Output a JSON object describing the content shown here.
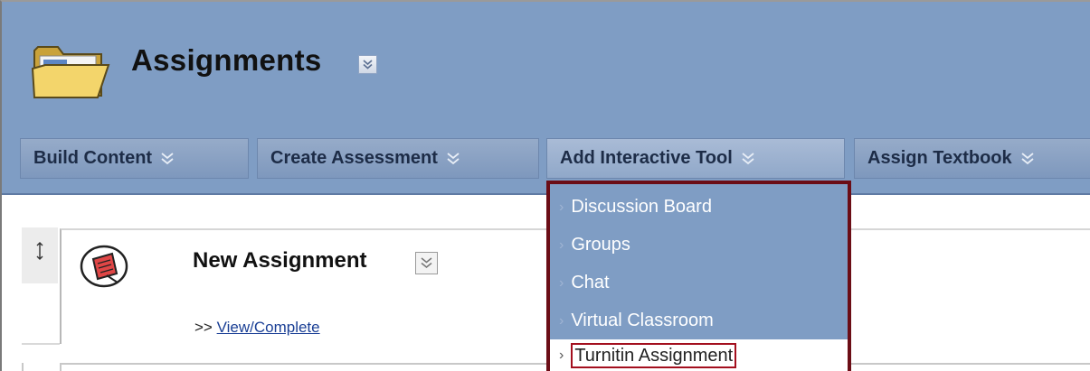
{
  "header": {
    "title": "Assignments",
    "background_color": "#7f9dc4"
  },
  "toolbar": {
    "buttons": [
      {
        "label": "Build Content"
      },
      {
        "label": "Create Assessment"
      },
      {
        "label": "Add Interactive Tool"
      },
      {
        "label": "Assign Textbook"
      }
    ]
  },
  "menu": {
    "items": [
      {
        "label": "Discussion Board"
      },
      {
        "label": "Groups"
      },
      {
        "label": "Chat"
      },
      {
        "label": "Virtual Classroom"
      },
      {
        "label": "Turnitin Assignment"
      }
    ],
    "selected_item": "Turnitin Assignment",
    "border_color": "#6b0d16"
  },
  "content": {
    "item_title": "New Assignment",
    "link_prefix": ">>",
    "link_label": "View/Complete"
  }
}
